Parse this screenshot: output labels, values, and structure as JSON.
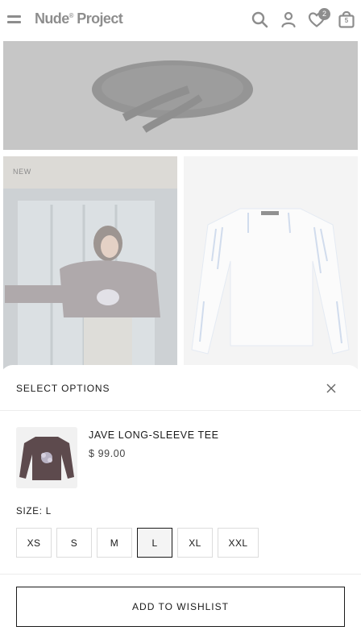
{
  "header": {
    "logo_text": "Nude",
    "logo_mark": "®",
    "logo_text_2": " Project",
    "wishlist_count": "2",
    "cart_count": "5",
    "icons": [
      "menu-icon",
      "search-icon",
      "account-icon",
      "heart-icon",
      "bag-icon"
    ]
  },
  "grid": {
    "new_label": "NEW"
  },
  "sheet": {
    "title": "SELECT OPTIONS",
    "product": {
      "name": "JAVE LONG-SLEEVE TEE",
      "price": "$ 99.00"
    },
    "size_label": "SIZE: L",
    "sizes": [
      "XS",
      "S",
      "M",
      "L",
      "XL",
      "XXL"
    ],
    "selected_size": "L",
    "wishlist_button": "ADD TO WISHLIST"
  },
  "colors": {
    "text": "#1a1a1a",
    "overlay": "rgba(255,255,255,0.5)",
    "border": "#dcdcdc"
  }
}
